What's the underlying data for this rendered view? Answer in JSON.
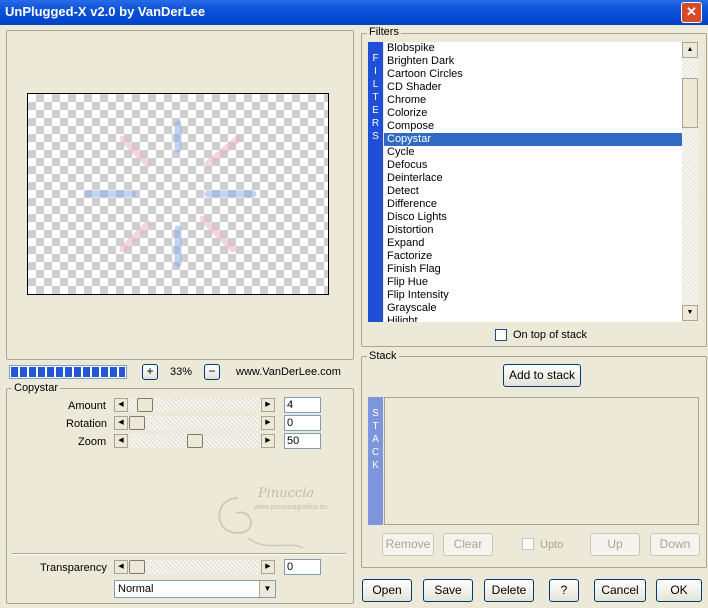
{
  "window": {
    "title": "UnPlugged-X v2.0 by VanDerLee",
    "close_glyph": "✕"
  },
  "preview": {
    "zoom": "33%",
    "zoom_plus": "+",
    "zoom_minus": "−",
    "website": "www.VanDerLee.com",
    "progress_fraction": 1.0
  },
  "filters": {
    "group_label": "Filters",
    "vertical_label": [
      "F",
      "I",
      "L",
      "T",
      "E",
      "R",
      "S"
    ],
    "items": [
      "Blobspike",
      "Brighten Dark",
      "Cartoon Circles",
      "CD Shader",
      "Chrome",
      "Colorize",
      "Compose",
      "Copystar",
      "Cycle",
      "Defocus",
      "Deinterlace",
      "Detect",
      "Difference",
      "Disco Lights",
      "Distortion",
      "Expand",
      "Factorize",
      "Finish Flag",
      "Flip Hue",
      "Flip Intensity",
      "Grayscale",
      "Hilight"
    ],
    "selected": "Copystar",
    "on_top_label": "On top of stack"
  },
  "params": {
    "group_label": "Copystar",
    "rows": [
      {
        "label": "Amount",
        "value": "4",
        "fraction": 0.05
      },
      {
        "label": "Rotation",
        "value": "0",
        "fraction": 0.0
      },
      {
        "label": "Zoom",
        "value": "50",
        "fraction": 0.5
      }
    ],
    "transparency": {
      "label": "Transparency",
      "value": "0",
      "fraction": 0.0
    },
    "blend_mode": "Normal"
  },
  "stack": {
    "group_label": "Stack",
    "add_button": "Add to stack",
    "vertical_label": [
      "S",
      "T",
      "A",
      "C",
      "K"
    ],
    "remove": "Remove",
    "clear": "Clear",
    "upto": "Upto",
    "up": "Up",
    "down": "Down"
  },
  "footer": {
    "open": "Open",
    "save": "Save",
    "delete": "Delete",
    "help": "?",
    "cancel": "Cancel",
    "ok": "OK"
  },
  "watermark": {
    "line1": "Pinuccia",
    "line2": "www.pinucciagrafica.eu"
  },
  "colors": {
    "title_blue": "#0a52d8",
    "select_blue": "#316ac5",
    "label_blue": "#1f4fd6",
    "stack_label_blue": "#7d95dc"
  }
}
